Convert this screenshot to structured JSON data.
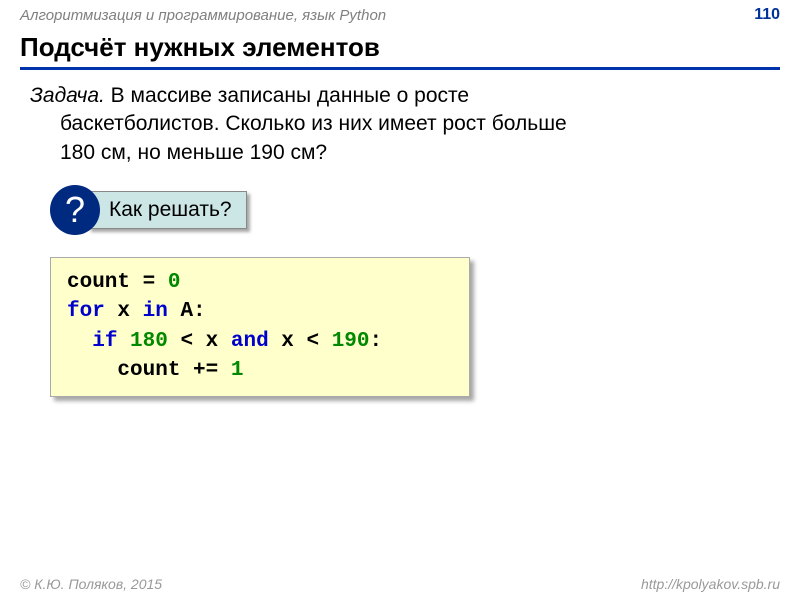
{
  "header": {
    "course": "Алгоритмизация и программирование, язык Python",
    "page": "110"
  },
  "section_title": "Подсчёт нужных элементов",
  "task": {
    "label": "Задача.",
    "line1": " В массиве записаны данные о росте",
    "line2": "баскетболистов. Сколько из них имеет рост больше",
    "line3": "180 см, но меньше 190 см?"
  },
  "hint": {
    "qmark": "?",
    "text": "Как решать?"
  },
  "code": {
    "t1": "count = ",
    "n0": "0",
    "t2": "for",
    "t3": " x ",
    "t4": "in",
    "t5": " A:",
    "t6": "  ",
    "t7": "if",
    "t8": " ",
    "n180": "180",
    "t9": " < x ",
    "t10": "and",
    "t11": " x < ",
    "n190": "190",
    "t12": ":",
    "t13": "    count += ",
    "n1": "1"
  },
  "footer": {
    "left": "© К.Ю. Поляков, 2015",
    "right": "http://kpolyakov.spb.ru"
  }
}
